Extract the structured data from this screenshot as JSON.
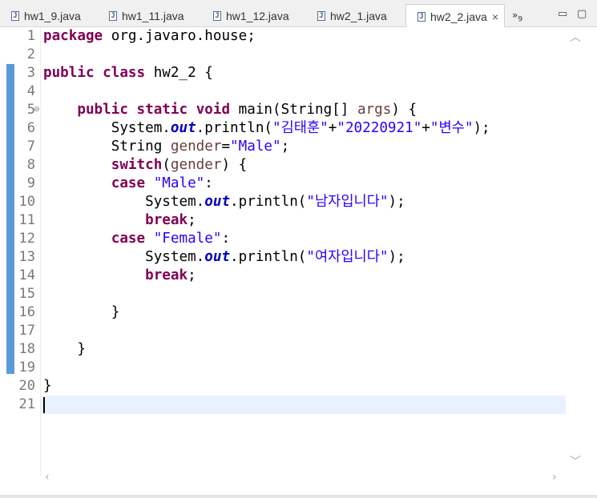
{
  "tabs": [
    {
      "label": "hw1_9.java",
      "active": false
    },
    {
      "label": "hw1_11.java",
      "active": false
    },
    {
      "label": "hw1_12.java",
      "active": false
    },
    {
      "label": "hw2_1.java",
      "active": false
    },
    {
      "label": "hw2_2.java",
      "active": true
    }
  ],
  "overflow": {
    "symbol": "»",
    "count": "9"
  },
  "window_controls": {
    "minimize": "▭",
    "maximize": "▢"
  },
  "active_close": "×",
  "icons": {
    "file": "java-file-icon",
    "fold": "fold-minus-icon",
    "up": "scroll-up-icon",
    "down": "scroll-down-icon",
    "left": "scroll-left-icon",
    "right": "scroll-right-icon"
  },
  "colors": {
    "keyword": "#7f0055",
    "string": "#2a00ff",
    "field": "#0000c0",
    "variable": "#6a3e3e",
    "current_line": "#e8f2fe",
    "quick_diff": "#5b9bd5"
  },
  "editor": {
    "line_numbers": [
      "1",
      "2",
      "3",
      "4",
      "5",
      "6",
      "7",
      "8",
      "9",
      "10",
      "11",
      "12",
      "13",
      "14",
      "15",
      "16",
      "17",
      "18",
      "19",
      "20",
      "21"
    ],
    "current_line": 21,
    "lines": [
      [
        {
          "t": "kw",
          "v": "package"
        },
        {
          "t": "pl",
          "v": " org.javaro.house;"
        }
      ],
      [],
      [
        {
          "t": "kw",
          "v": "public"
        },
        {
          "t": "pl",
          "v": " "
        },
        {
          "t": "kw",
          "v": "class"
        },
        {
          "t": "pl",
          "v": " hw2_2 {"
        }
      ],
      [],
      [
        {
          "t": "pl",
          "v": "    "
        },
        {
          "t": "kw",
          "v": "public"
        },
        {
          "t": "pl",
          "v": " "
        },
        {
          "t": "kw",
          "v": "static"
        },
        {
          "t": "pl",
          "v": " "
        },
        {
          "t": "kw",
          "v": "void"
        },
        {
          "t": "pl",
          "v": " main(String[] "
        },
        {
          "t": "var",
          "v": "args"
        },
        {
          "t": "pl",
          "v": ") {"
        }
      ],
      [
        {
          "t": "pl",
          "v": "        System."
        },
        {
          "t": "fld",
          "v": "out"
        },
        {
          "t": "pl",
          "v": ".println("
        },
        {
          "t": "st",
          "v": "\"김태훈\""
        },
        {
          "t": "pl",
          "v": "+"
        },
        {
          "t": "st",
          "v": "\"20220921\""
        },
        {
          "t": "pl",
          "v": "+"
        },
        {
          "t": "st",
          "v": "\"변수\""
        },
        {
          "t": "pl",
          "v": ");"
        }
      ],
      [
        {
          "t": "pl",
          "v": "        String "
        },
        {
          "t": "var",
          "v": "gender"
        },
        {
          "t": "pl",
          "v": "="
        },
        {
          "t": "st",
          "v": "\"Male\""
        },
        {
          "t": "pl",
          "v": ";"
        }
      ],
      [
        {
          "t": "pl",
          "v": "        "
        },
        {
          "t": "kw",
          "v": "switch"
        },
        {
          "t": "pl",
          "v": "("
        },
        {
          "t": "var",
          "v": "gender"
        },
        {
          "t": "pl",
          "v": ") {"
        }
      ],
      [
        {
          "t": "pl",
          "v": "        "
        },
        {
          "t": "kw",
          "v": "case"
        },
        {
          "t": "pl",
          "v": " "
        },
        {
          "t": "st",
          "v": "\"Male\""
        },
        {
          "t": "pl",
          "v": ":"
        }
      ],
      [
        {
          "t": "pl",
          "v": "            System."
        },
        {
          "t": "fld",
          "v": "out"
        },
        {
          "t": "pl",
          "v": ".println("
        },
        {
          "t": "st",
          "v": "\"남자입니다\""
        },
        {
          "t": "pl",
          "v": ");"
        }
      ],
      [
        {
          "t": "pl",
          "v": "            "
        },
        {
          "t": "kw",
          "v": "break"
        },
        {
          "t": "pl",
          "v": ";"
        }
      ],
      [
        {
          "t": "pl",
          "v": "        "
        },
        {
          "t": "kw",
          "v": "case"
        },
        {
          "t": "pl",
          "v": " "
        },
        {
          "t": "st",
          "v": "\"Female\""
        },
        {
          "t": "pl",
          "v": ":"
        }
      ],
      [
        {
          "t": "pl",
          "v": "            System."
        },
        {
          "t": "fld",
          "v": "out"
        },
        {
          "t": "pl",
          "v": ".println("
        },
        {
          "t": "st",
          "v": "\"여자입니다\""
        },
        {
          "t": "pl",
          "v": ");"
        }
      ],
      [
        {
          "t": "pl",
          "v": "            "
        },
        {
          "t": "kw",
          "v": "break"
        },
        {
          "t": "pl",
          "v": ";"
        }
      ],
      [],
      [
        {
          "t": "pl",
          "v": "        }"
        }
      ],
      [],
      [
        {
          "t": "pl",
          "v": "    }"
        }
      ],
      [],
      [
        {
          "t": "pl",
          "v": "}"
        }
      ],
      []
    ]
  }
}
